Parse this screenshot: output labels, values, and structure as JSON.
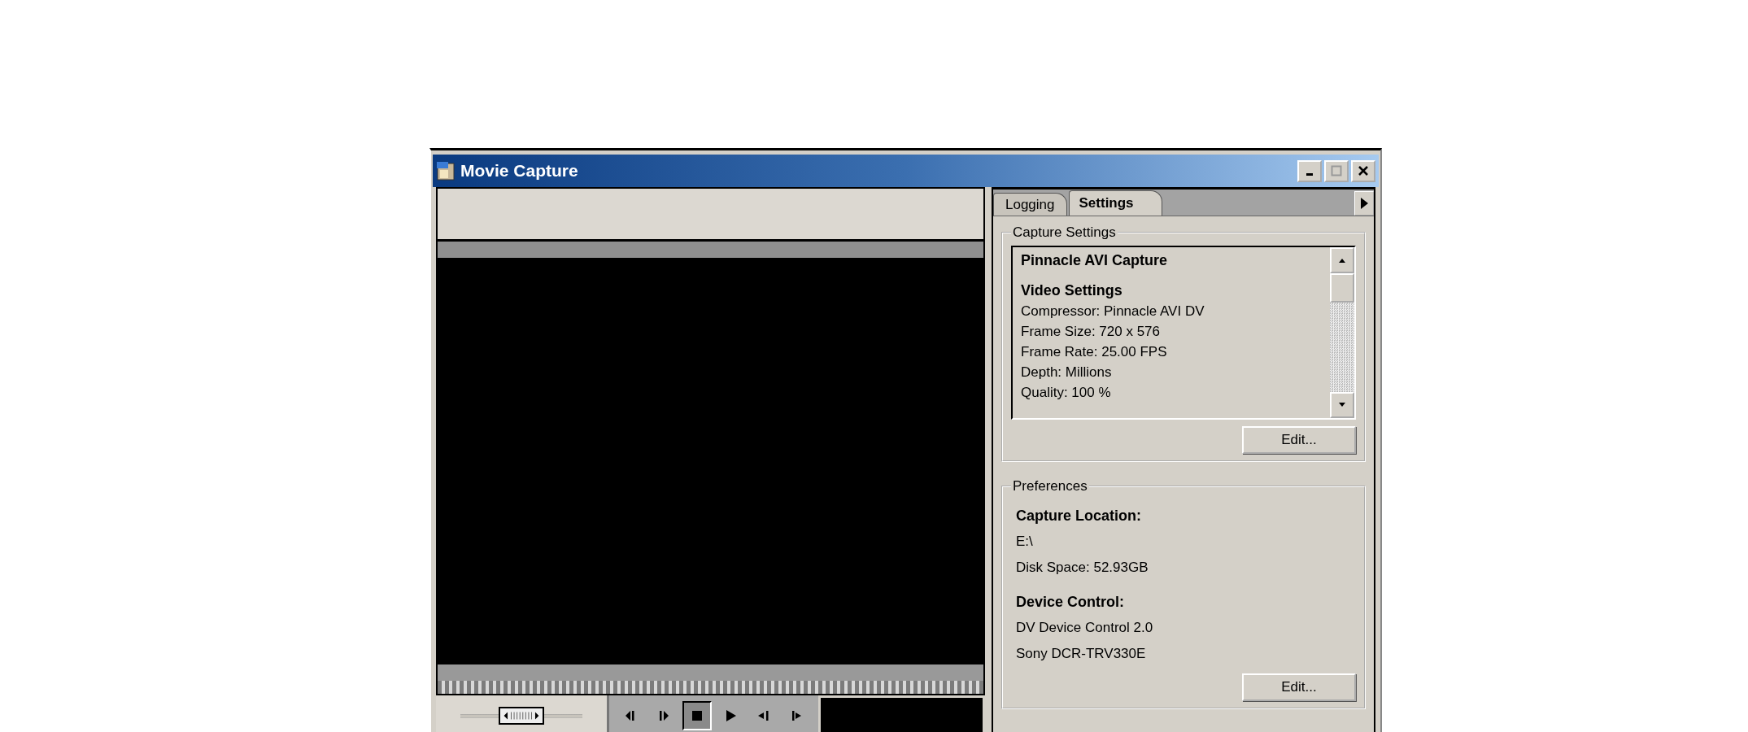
{
  "window": {
    "title": "Movie Capture"
  },
  "tabs": [
    {
      "label": "Logging",
      "selected": false
    },
    {
      "label": "Settings",
      "selected": true
    }
  ],
  "capture_settings": {
    "title": "Capture Settings",
    "lines": [
      {
        "kind": "heading",
        "text": "Pinnacle AVI Capture"
      },
      {
        "kind": "heading",
        "text": "Video Settings"
      },
      {
        "kind": "text",
        "text": "Compressor: Pinnacle AVI DV"
      },
      {
        "kind": "text",
        "text": "Frame Size: 720 x 576"
      },
      {
        "kind": "text",
        "text": "Frame Rate: 25.00 FPS"
      },
      {
        "kind": "text",
        "text": "Depth: Millions"
      },
      {
        "kind": "text",
        "text": "Quality: 100 %"
      }
    ],
    "button": "Edit..."
  },
  "preferences": {
    "title": "Preferences",
    "lines": [
      {
        "kind": "heading",
        "text": "Capture Location:"
      },
      {
        "kind": "text",
        "text": "E:\\"
      },
      {
        "kind": "text",
        "text": "Disk Space: 52.93GB"
      },
      {
        "kind": "heading",
        "text": "Device Control:"
      },
      {
        "kind": "text",
        "text": "DV Device Control 2.0"
      },
      {
        "kind": "text",
        "text": "Sony DCR-TRV330E"
      }
    ],
    "button": "Edit..."
  },
  "shuttle": {
    "level": 0.5
  },
  "transport": [
    {
      "kind": "step_back",
      "selected": false
    },
    {
      "kind": "step_forward",
      "selected": false
    },
    {
      "kind": "stop",
      "selected": true
    },
    {
      "kind": "play",
      "selected": false
    },
    {
      "kind": "go_in",
      "selected": false
    },
    {
      "kind": "go_out",
      "selected": false
    }
  ]
}
